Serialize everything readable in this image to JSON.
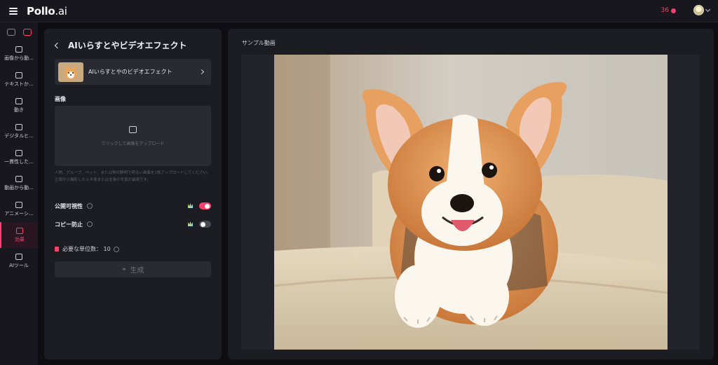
{
  "app": {
    "logo_main": "Pollo",
    "logo_suffix": ".ai",
    "credits": "36"
  },
  "sidebar": {
    "items": [
      {
        "label": "画像から動..."
      },
      {
        "label": "テキストか..."
      },
      {
        "label": "動き"
      },
      {
        "label": "デジタルヒ..."
      },
      {
        "label": "一貫性した..."
      },
      {
        "label": "動画から動..."
      },
      {
        "label": "アニメーシ..."
      },
      {
        "label": "効果"
      },
      {
        "label": "AIツール"
      }
    ],
    "active_index": 7
  },
  "panel": {
    "title": "AIいらすとやビデオエフェクト",
    "effect_name": "AIいらすとやのビデオエフェクト",
    "image_label": "画像",
    "upload_text": "クリックして画像をアップロード",
    "hint_text": "人物、グループ、ペット、または物の鮮明で明るい画像を1枚アップロードしてください。正面から撮影した上半身または全身の写真が最適です。",
    "public_label": "公開可視性",
    "public_on": true,
    "copy_label": "コピー防止",
    "copy_on": false,
    "units_text": "必要な単位数： 10",
    "generate_label": "生成"
  },
  "preview": {
    "title": "サンプル動画"
  },
  "colors": {
    "accent": "#ff3e6c",
    "panel_bg": "#1c1c23",
    "page_bg": "#0e0e12"
  },
  "icons": [
    "menu-icon",
    "image-mode-icon",
    "video-mode-icon",
    "user-avatar",
    "back-chevron-icon",
    "chevron-right-icon",
    "upload-image-icon",
    "info-icon",
    "crown-icon",
    "sparkle-icon",
    "trash-icon"
  ]
}
